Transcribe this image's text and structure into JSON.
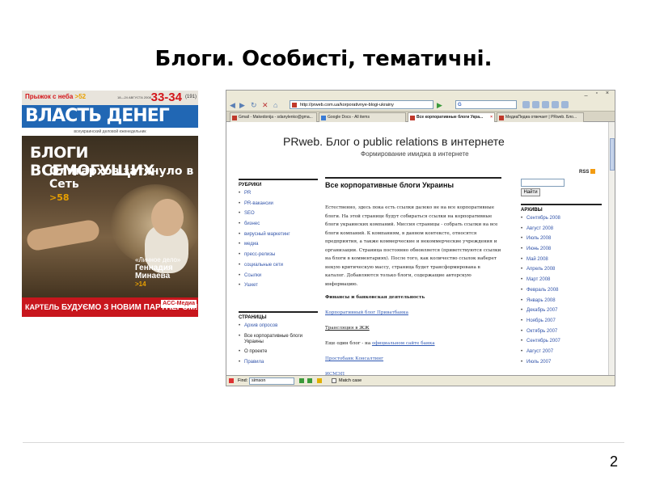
{
  "slide": {
    "title": "Блоги. Особисті, тематичні.",
    "number": "2"
  },
  "magazine": {
    "jump_text": "Прыжок с неба",
    "jump_page": ">52",
    "date": "18—24 АВГУСТА 2008",
    "issue": "33-34",
    "issue_num": "(191)",
    "masthead_left": "ВЛАСТЬ",
    "masthead_right": "ДЕНЕГ",
    "tagline": "всеукраинский деловой еженедельник",
    "headline": "БЛОГИ ВСЕМОГУЩИХ",
    "subhead": "Олигархов затянуло в Сеть",
    "subhead_page": ">58",
    "feature_label": "«Личное дело»",
    "feature_name": "Геннадия Минаева",
    "feature_page": ">14",
    "banner_brand": "КАРТЕЛЬ",
    "banner_text": "БУДУЄМО З НОВИМ ПАРТНЕРОМ!",
    "banner_partner": "ACC-Медиа"
  },
  "browser": {
    "url": "http://prweb.com.ua/korporativnye-blogi-ukrainy",
    "search_engine": "G",
    "tabs": [
      {
        "label": "Gmail - Makedonija - sdanylenko@gma...",
        "active": false
      },
      {
        "label": "Google Docs - All items",
        "active": false
      },
      {
        "label": "Все корпоративные блоги Укра...",
        "active": true
      },
      {
        "label": "МедиаПедиа отвечает | PRweb. Бло...",
        "active": false
      }
    ],
    "site": {
      "title": "PRweb. Блог о public relations в интернете",
      "subtitle": "Формирование имиджа в интернете",
      "rss": "RSS"
    },
    "left": {
      "rubrics_heading": "РУБРИКИ",
      "rubrics": [
        "PR",
        "PR-вакансии",
        "SEO",
        "бизнес",
        "вирусный маркетинг",
        "медиа",
        "пресс-релизы",
        "социальные сети",
        "Ссылки",
        "Ушкет"
      ],
      "pages_heading": "СТРАНИЦЫ",
      "pages": [
        "Архив опросов",
        "Все корпоративные блоги Украины",
        "О проекте",
        "Правила"
      ]
    },
    "post": {
      "title": "Все корпоративные блоги Украины",
      "body": "Естественно, здесь пока есть ссылки далеко не на все корпоративные блоги. На этой странице будут собираться ссылки на корпоративные блоги украинских компаний. Миссия страницы - собрать ссылки на все блоги компаний. К компаниям, в данном контексте, относятся предприятия, а также коммерческие и некоммерческие учреждения и организации. Страница постоянно обновляется (приветствуются ссылки на блоги в комментариях). После того, как количество ссылок наберет некую критическую массу, страница будет трансформирована в каталог. Добавляются только блоги, содержащие авторскую информацию.",
      "section": "Финансы и банковская деятельность",
      "link1": "Корпоративный блог Приватбанка",
      "item2": "Трансляция в ЖЖ",
      "item3_prefix": "Еще один блог - на ",
      "item3_link": "официальном сайте банка",
      "link4": "Простобанк Консалтинг",
      "link5": "ИСМЭП"
    },
    "right": {
      "search_button": "Найти",
      "archives_heading": "АРХИВЫ",
      "archives": [
        "Сентябрь 2008",
        "Август 2008",
        "Июль 2008",
        "Июнь 2008",
        "Май 2008",
        "Апрель 2008",
        "Март 2008",
        "Февраль 2008",
        "Январь 2008",
        "Декабрь 2007",
        "Ноябрь 2007",
        "Октябрь 2007",
        "Сентябрь 2007",
        "Август 2007",
        "Июль 2007"
      ]
    },
    "findbar": {
      "label": "Find:",
      "value": "simson",
      "match_case": "Match case"
    }
  },
  "colors": {
    "masthead_blue": "#2167b4",
    "magazine_red": "#c8161d",
    "link_blue": "#3355aa"
  }
}
